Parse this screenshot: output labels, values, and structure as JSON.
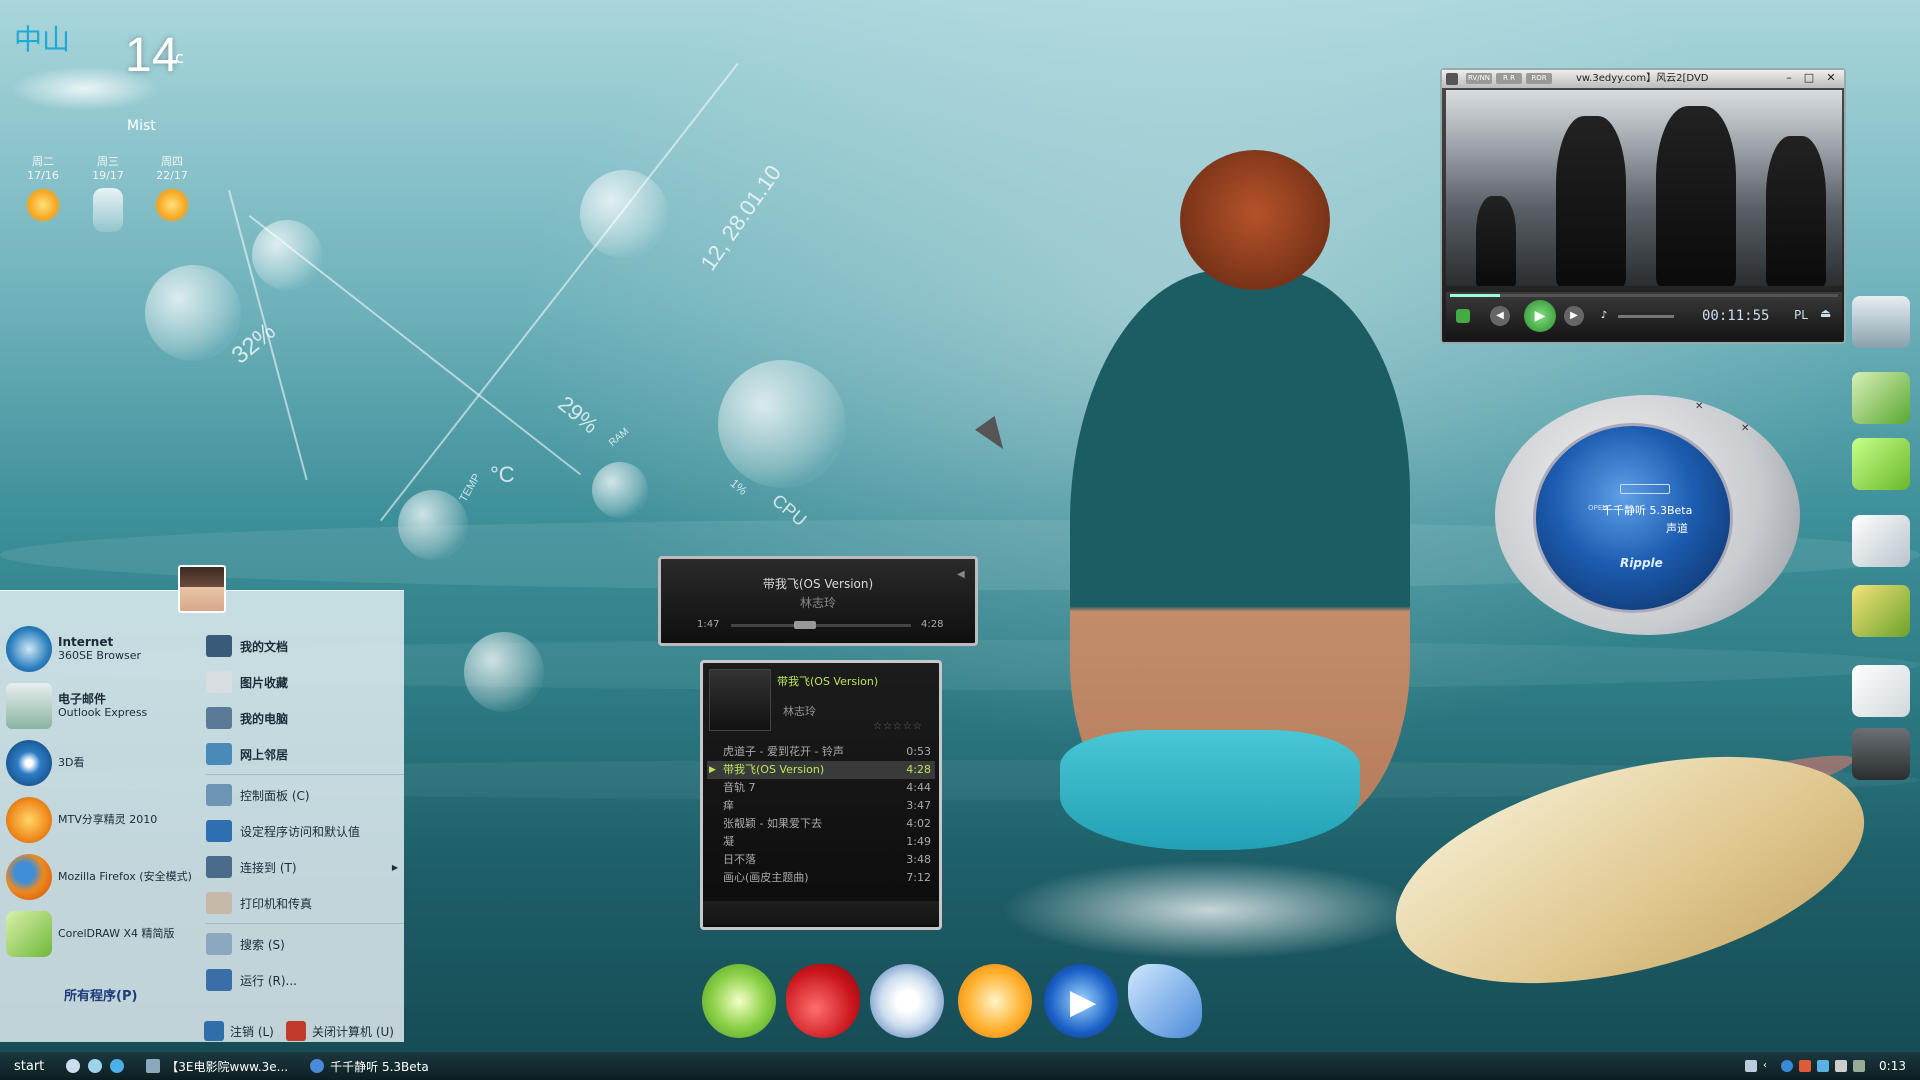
{
  "weather": {
    "city": "中山",
    "temp": "14",
    "unit": "c",
    "condition": "Mist",
    "forecast": [
      {
        "day": "周二",
        "range": "17/16",
        "icon": "sunny-icon"
      },
      {
        "day": "周三",
        "range": "19/17",
        "icon": "rain-icon"
      },
      {
        "day": "周四",
        "range": "22/17",
        "icon": "sunny-icon"
      }
    ]
  },
  "system_stats": {
    "disk": "32%",
    "ram": "29%",
    "ram_label": "RAM",
    "cpu_label": "CPU",
    "temp_label": "TEMP",
    "datetime": "12, 28.01.10",
    "cpu_value": "1%",
    "temp_unit": "°C"
  },
  "start_menu": {
    "pinned": [
      {
        "name": "Internet",
        "sub": "360SE Browser",
        "icon": "360se-browser-icon"
      },
      {
        "name": "电子邮件",
        "sub": "Outlook Express",
        "icon": "outlook-express-icon"
      },
      {
        "name": "3D看",
        "sub": "",
        "icon": "3d-viewer-icon"
      },
      {
        "name": "MTV分享精灵 2010",
        "sub": "",
        "icon": "mtv-share-icon"
      },
      {
        "name": "Mozilla Firefox (安全模式)",
        "sub": "",
        "icon": "firefox-icon"
      },
      {
        "name": "CorelDRAW X4 精简版",
        "sub": "",
        "icon": "coreldraw-icon"
      }
    ],
    "all_programs": "所有程序(P)",
    "right_items": [
      {
        "label": "我的文档",
        "icon": "my-documents-icon",
        "bold": true
      },
      {
        "label": "图片收藏",
        "icon": "my-pictures-icon",
        "bold": true
      },
      {
        "label": "我的电脑",
        "icon": "my-computer-icon",
        "bold": true
      },
      {
        "label": "网上邻居",
        "icon": "network-places-icon",
        "bold": true
      },
      {
        "label": "控制面板 (C)",
        "icon": "control-panel-icon",
        "bold": false
      },
      {
        "label": "设定程序访问和默认值",
        "icon": "default-programs-icon",
        "bold": false
      },
      {
        "label": "连接到 (T)",
        "icon": "connect-to-icon",
        "bold": false
      },
      {
        "label": "打印机和传真",
        "icon": "printers-icon",
        "bold": false
      },
      {
        "label": "搜索 (S)",
        "icon": "search-icon",
        "bold": false
      },
      {
        "label": "运行 (R)...",
        "icon": "run-icon",
        "bold": false
      }
    ],
    "logoff": "注销 (L)",
    "shutdown": "关闭计算机 (U)"
  },
  "taskbar": {
    "start": "start",
    "tasks": [
      {
        "label": "【3E电影院www.3e...",
        "icon": "video-player-task-icon"
      },
      {
        "label": "千千静听 5.3Beta",
        "icon": "ttplayer-task-icon"
      }
    ],
    "clock": "0:13"
  },
  "mini_player": {
    "title": "带我飞(OS Version)",
    "artist": "林志玲",
    "elapsed": "1:47",
    "total": "4:28",
    "progress": 0.4
  },
  "playlist": {
    "now_title": "带我飞(OS Version)",
    "now_artist": "林志玲",
    "stars": "☆☆☆☆☆",
    "tracks": [
      {
        "name": "虎道子 - 爱到花开 - 铃声",
        "time": "0:53",
        "current": false
      },
      {
        "name": "带我飞(OS Version)",
        "time": "4:28",
        "current": true
      },
      {
        "name": "音轨 7",
        "time": "4:44",
        "current": false
      },
      {
        "name": "痒",
        "time": "3:47",
        "current": false
      },
      {
        "name": "张靓颖 - 如果爱下去",
        "time": "4:02",
        "current": false
      },
      {
        "name": "凝",
        "time": "1:49",
        "current": false
      },
      {
        "name": "日不落",
        "time": "3:48",
        "current": false
      },
      {
        "name": "画心(画皮主题曲)",
        "time": "7:12",
        "current": false
      }
    ]
  },
  "video_player": {
    "title": "vw.3edyy.com】风云2[DVD",
    "tb_buttons": [
      "RV/NN",
      "R R",
      "ROR"
    ],
    "time": "00:11:55",
    "pl_label": "PL",
    "progress": 0.13
  },
  "ttplayer": {
    "name": "千千静听 5.3Beta",
    "channel": "声道",
    "brand": "Ripple",
    "open_label": "OPEN"
  }
}
